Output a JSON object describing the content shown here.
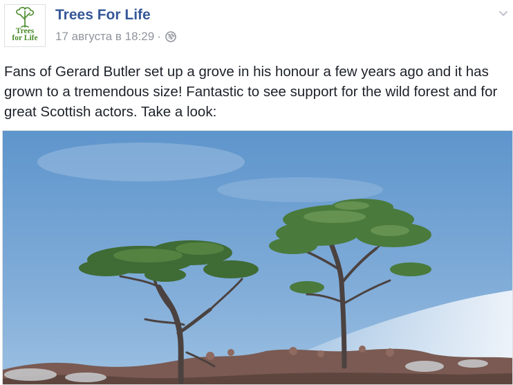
{
  "post": {
    "page_name": "Trees For Life",
    "avatar": {
      "logo_line1": "Trees",
      "logo_line2": "for Life",
      "icon": "tree-logo-icon"
    },
    "timestamp": "17 августа в 18:29",
    "separator": "·",
    "privacy_icon": "globe-icon",
    "options_icon": "chevron-down-icon",
    "text": "Fans of Gerard Butler set up a grove in his honour a few years ago and it has grown to a tremendous size! Fantastic to see support for the wild forest and for great Scottish actors. Take a look:",
    "photo": {
      "content": "two-pine-trees-photo"
    }
  },
  "colors": {
    "link": "#365899",
    "meta": "#90949c",
    "text": "#1d2129",
    "logo_green": "#4a8a2a"
  }
}
